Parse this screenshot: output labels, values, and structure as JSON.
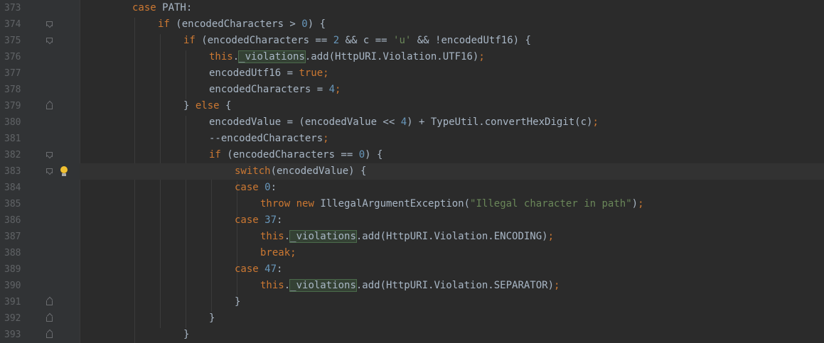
{
  "editor": {
    "lines": [
      {
        "number": "373",
        "indent": 0,
        "fold": "none",
        "tokens": [
          {
            "t": "case",
            "c": "kw"
          },
          {
            "t": " PATH:",
            "c": "p"
          }
        ]
      },
      {
        "number": "374",
        "indent": 1,
        "fold": "open",
        "tokens": [
          {
            "t": "if",
            "c": "kw"
          },
          {
            "t": " (encodedCharacters > ",
            "c": "p"
          },
          {
            "t": "0",
            "c": "num"
          },
          {
            "t": ") {",
            "c": "p"
          }
        ]
      },
      {
        "number": "375",
        "indent": 2,
        "fold": "open",
        "tokens": [
          {
            "t": "if",
            "c": "kw"
          },
          {
            "t": " (encodedCharacters == ",
            "c": "p"
          },
          {
            "t": "2",
            "c": "num"
          },
          {
            "t": " && c == ",
            "c": "p"
          },
          {
            "t": "'u'",
            "c": "str"
          },
          {
            "t": " && !encodedUtf16) {",
            "c": "p"
          }
        ]
      },
      {
        "number": "376",
        "indent": 3,
        "fold": "none",
        "tokens": [
          {
            "t": "this",
            "c": "kw"
          },
          {
            "t": ".",
            "c": "p"
          },
          {
            "t": "_violations",
            "c": "field"
          },
          {
            "t": ".add(HttpURI.Violation.UTF16)",
            "c": "p"
          },
          {
            "t": ";",
            "c": "kw"
          }
        ]
      },
      {
        "number": "377",
        "indent": 3,
        "fold": "none",
        "tokens": [
          {
            "t": "encodedUtf16 = ",
            "c": "p"
          },
          {
            "t": "true",
            "c": "kw"
          },
          {
            "t": ";",
            "c": "kw"
          }
        ]
      },
      {
        "number": "378",
        "indent": 3,
        "fold": "none",
        "tokens": [
          {
            "t": "encodedCharacters = ",
            "c": "p"
          },
          {
            "t": "4",
            "c": "num"
          },
          {
            "t": ";",
            "c": "kw"
          }
        ]
      },
      {
        "number": "379",
        "indent": 2,
        "fold": "close",
        "tokens": [
          {
            "t": "} ",
            "c": "p"
          },
          {
            "t": "else",
            "c": "kw"
          },
          {
            "t": " {",
            "c": "p"
          }
        ]
      },
      {
        "number": "380",
        "indent": 3,
        "fold": "none",
        "tokens": [
          {
            "t": "encodedValue = (encodedValue << ",
            "c": "p"
          },
          {
            "t": "4",
            "c": "num"
          },
          {
            "t": ") + TypeUtil.convertHexDigit(c)",
            "c": "p"
          },
          {
            "t": ";",
            "c": "kw"
          }
        ]
      },
      {
        "number": "381",
        "indent": 3,
        "fold": "none",
        "tokens": [
          {
            "t": "--encodedCharacters",
            "c": "p"
          },
          {
            "t": ";",
            "c": "kw"
          }
        ]
      },
      {
        "number": "382",
        "indent": 3,
        "fold": "open",
        "tokens": [
          {
            "t": "if",
            "c": "kw"
          },
          {
            "t": " (encodedCharacters == ",
            "c": "p"
          },
          {
            "t": "0",
            "c": "num"
          },
          {
            "t": ") {",
            "c": "p"
          }
        ]
      },
      {
        "number": "383",
        "indent": 4,
        "fold": "open",
        "current": true,
        "bulb": true,
        "tokens": [
          {
            "t": "switch",
            "c": "kw"
          },
          {
            "t": "(encodedValue) {",
            "c": "p"
          }
        ]
      },
      {
        "number": "384",
        "indent": 4,
        "fold": "none",
        "tokens": [
          {
            "t": "case",
            "c": "kw"
          },
          {
            "t": " ",
            "c": "p"
          },
          {
            "t": "0",
            "c": "num"
          },
          {
            "t": ":",
            "c": "p"
          }
        ]
      },
      {
        "number": "385",
        "indent": 5,
        "fold": "none",
        "tokens": [
          {
            "t": "throw",
            "c": "kw"
          },
          {
            "t": " ",
            "c": "p"
          },
          {
            "t": "new",
            "c": "kw"
          },
          {
            "t": " IllegalArgumentException(",
            "c": "p"
          },
          {
            "t": "\"Illegal character in path\"",
            "c": "str"
          },
          {
            "t": ")",
            "c": "p"
          },
          {
            "t": ";",
            "c": "kw"
          }
        ]
      },
      {
        "number": "386",
        "indent": 4,
        "fold": "none",
        "tokens": [
          {
            "t": "case",
            "c": "kw"
          },
          {
            "t": " ",
            "c": "p"
          },
          {
            "t": "37",
            "c": "num"
          },
          {
            "t": ":",
            "c": "p"
          }
        ]
      },
      {
        "number": "387",
        "indent": 5,
        "fold": "none",
        "tokens": [
          {
            "t": "this",
            "c": "kw"
          },
          {
            "t": ".",
            "c": "p"
          },
          {
            "t": "_violations",
            "c": "field"
          },
          {
            "t": ".add(HttpURI.Violation.ENCODING)",
            "c": "p"
          },
          {
            "t": ";",
            "c": "kw"
          }
        ]
      },
      {
        "number": "388",
        "indent": 5,
        "fold": "none",
        "tokens": [
          {
            "t": "break",
            "c": "kw"
          },
          {
            "t": ";",
            "c": "kw"
          }
        ]
      },
      {
        "number": "389",
        "indent": 4,
        "fold": "none",
        "tokens": [
          {
            "t": "case",
            "c": "kw"
          },
          {
            "t": " ",
            "c": "p"
          },
          {
            "t": "47",
            "c": "num"
          },
          {
            "t": ":",
            "c": "p"
          }
        ]
      },
      {
        "number": "390",
        "indent": 5,
        "fold": "none",
        "tokens": [
          {
            "t": "this",
            "c": "kw"
          },
          {
            "t": ".",
            "c": "p"
          },
          {
            "t": "_violations",
            "c": "field"
          },
          {
            "t": ".add(HttpURI.Violation.SEPARATOR)",
            "c": "p"
          },
          {
            "t": ";",
            "c": "kw"
          }
        ]
      },
      {
        "number": "391",
        "indent": 4,
        "fold": "close",
        "tokens": [
          {
            "t": "}",
            "c": "p"
          }
        ]
      },
      {
        "number": "392",
        "indent": 3,
        "fold": "close",
        "tokens": [
          {
            "t": "}",
            "c": "p"
          }
        ]
      },
      {
        "number": "393",
        "indent": 2,
        "fold": "close",
        "tokens": [
          {
            "t": "}",
            "c": "p"
          }
        ]
      }
    ]
  },
  "colors": {
    "background": "#2b2b2b",
    "gutter": "#313335",
    "keyword": "#cc7832",
    "number": "#6897bb",
    "string": "#6a8759",
    "plain": "#a9b7c6",
    "line_number": "#606366",
    "usage_highlight": "#344134",
    "current_line": "#323232"
  },
  "icons": {
    "intention": "lightbulb-icon",
    "fold_start": "fold-marker-icon",
    "fold_end": "fold-end-icon"
  }
}
